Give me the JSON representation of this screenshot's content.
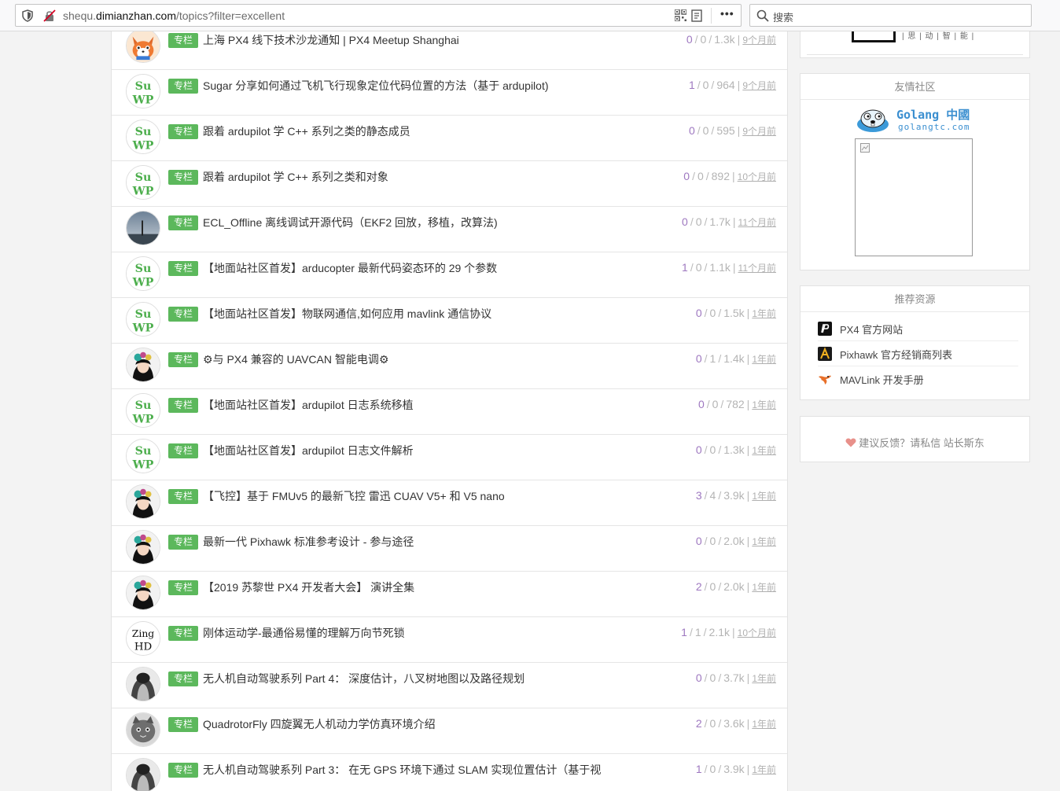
{
  "browser": {
    "url_prefix": "shequ.",
    "url_domain": "dimianzhan.com",
    "url_path": "/topics?filter=excellent",
    "menu_dots": "•••",
    "search_placeholder": "搜索"
  },
  "topics": [
    {
      "tag": "专栏",
      "title": "上海 PX4 线下技术沙龙通知 | PX4 Meetup Shanghai",
      "replies": "0",
      "likes": "0",
      "views": "1.3k",
      "time": "9个月前",
      "avatar": "fox"
    },
    {
      "tag": "专栏",
      "title": "Sugar 分享如何通过飞机飞行现象定位代码位置的方法（基于 ardupilot)",
      "replies": "1",
      "likes": "0",
      "views": "964",
      "time": "9个月前",
      "avatar": "suwp"
    },
    {
      "tag": "专栏",
      "title": "跟着 ardupilot 学 C++ 系列之类的静态成员",
      "replies": "0",
      "likes": "0",
      "views": "595",
      "time": "9个月前",
      "avatar": "suwp"
    },
    {
      "tag": "专栏",
      "title": "跟着 ardupilot 学 C++ 系列之类和对象",
      "replies": "0",
      "likes": "0",
      "views": "892",
      "time": "10个月前",
      "avatar": "suwp"
    },
    {
      "tag": "专栏",
      "title": "ECL_Offline 离线调试开源代码（EKF2 回放，移植，改算法)",
      "replies": "0",
      "likes": "0",
      "views": "1.7k",
      "time": "11个月前",
      "avatar": "sky"
    },
    {
      "tag": "专栏",
      "title": "【地面站社区首发】arducopter 最新代码姿态环的 29 个参数",
      "replies": "1",
      "likes": "0",
      "views": "1.1k",
      "time": "11个月前",
      "avatar": "suwp"
    },
    {
      "tag": "专栏",
      "title": "【地面站社区首发】物联网通信,如何应用 mavlink 通信协议",
      "replies": "0",
      "likes": "0",
      "views": "1.5k",
      "time": "1年前",
      "avatar": "suwp"
    },
    {
      "tag": "专栏",
      "title": "⚙与 PX4 兼容的 UAVCAN 智能电调⚙",
      "replies": "0",
      "likes": "1",
      "views": "1.4k",
      "time": "1年前",
      "avatar": "girl"
    },
    {
      "tag": "专栏",
      "title": "【地面站社区首发】ardupilot 日志系统移植",
      "replies": "0",
      "likes": "0",
      "views": "782",
      "time": "1年前",
      "avatar": "suwp"
    },
    {
      "tag": "专栏",
      "title": "【地面站社区首发】ardupilot 日志文件解析",
      "replies": "0",
      "likes": "0",
      "views": "1.3k",
      "time": "1年前",
      "avatar": "suwp"
    },
    {
      "tag": "专栏",
      "title": "【飞控】基于 FMUv5 的最新飞控 雷迅 CUAV V5+ 和 V5 nano",
      "replies": "3",
      "likes": "4",
      "views": "3.9k",
      "time": "1年前",
      "avatar": "girl"
    },
    {
      "tag": "专栏",
      "title": "最新一代 Pixhawk 标准参考设计 - 参与途径",
      "replies": "0",
      "likes": "0",
      "views": "2.0k",
      "time": "1年前",
      "avatar": "girl"
    },
    {
      "tag": "专栏",
      "title": "【2019 苏黎世 PX4 开发者大会】 演讲全集",
      "replies": "2",
      "likes": "0",
      "views": "2.0k",
      "time": "1年前",
      "avatar": "girl"
    },
    {
      "tag": "专栏",
      "title": "刚体运动学-最通俗易懂的理解万向节死锁",
      "replies": "1",
      "likes": "1",
      "views": "2.1k",
      "time": "10个月前",
      "avatar": "zing"
    },
    {
      "tag": "专栏",
      "title": "无人机自动驾驶系列 Part 4： 深度估计，八叉树地图以及路径规划",
      "replies": "0",
      "likes": "0",
      "views": "3.7k",
      "time": "1年前",
      "avatar": "bw"
    },
    {
      "tag": "专栏",
      "title": "QuadrotorFly 四旋翼无人机动力学仿真环境介绍",
      "replies": "2",
      "likes": "0",
      "views": "3.6k",
      "time": "1年前",
      "avatar": "cat"
    },
    {
      "tag": "专栏",
      "title": "无人机自动驾驶系列 Part 3： 在无 GPS 环境下通过 SLAM 实现位置估计（基于视",
      "replies": "1",
      "likes": "0",
      "views": "3.9k",
      "time": "1年前",
      "avatar": "bw"
    }
  ],
  "avatar_text": {
    "suwp_top": "Su",
    "suwp_bottom": "WP",
    "zing_top": "Zing",
    "zing_bottom": "HD"
  },
  "sidebar": {
    "partner_strip": "| 思 | 动 | 智 | 能 |",
    "friends_title": "友情社区",
    "golang_text": "Golang 中國",
    "golang_url": "golangtc.com",
    "resources_title": "推荐资源",
    "resources": [
      {
        "label": "PX4 官方网站",
        "icon": "px4-logo-icon"
      },
      {
        "label": "Pixhawk 官方经销商列表",
        "icon": "pixhawk-logo-icon"
      },
      {
        "label": "MAVLink 开发手册",
        "icon": "mavlink-logo-icon"
      }
    ],
    "feedback_text": "建议反馈？请私信 站长斯东"
  }
}
